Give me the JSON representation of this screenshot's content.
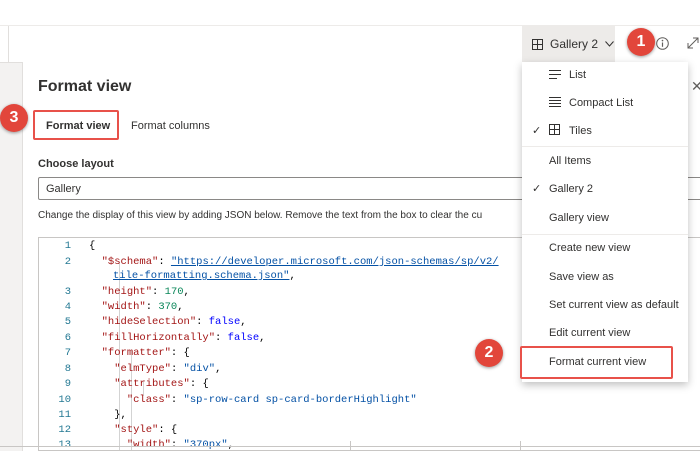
{
  "header": {
    "view_switcher_label": "Gallery 2"
  },
  "panel": {
    "title": "Format view",
    "tabs": [
      {
        "label": "Format view",
        "selected": true
      },
      {
        "label": "Format columns",
        "selected": false
      }
    ],
    "choose_layout_label": "Choose layout",
    "layout_value": "Gallery",
    "help_text": "Change the display of this view by adding JSON below. Remove the text from the box to clear the cu"
  },
  "editor": {
    "line_numbers": [
      "1",
      "2",
      "",
      "3",
      "4",
      "5",
      "6",
      "7",
      "8",
      "9",
      "10",
      "11",
      "12",
      "13"
    ],
    "code": {
      "l1": "{",
      "l2_key": "\"$schema\"",
      "l2_url": "\"https://developer.microsoft.com/json-schemas/sp/v2/",
      "l2b_url": "tile-formatting.schema.json\"",
      "l3_key": "\"height\"",
      "l3_val": "170",
      "l4_key": "\"width\"",
      "l4_val": "370",
      "l5_key": "\"hideSelection\"",
      "l5_val": "false",
      "l6_key": "\"fillHorizontally\"",
      "l6_val": "false",
      "l7_key": "\"formatter\"",
      "l8_key": "\"elmType\"",
      "l8_val": "\"div\"",
      "l9_key": "\"attributes\"",
      "l10_key": "\"class\"",
      "l10_val": "\"sp-row-card sp-card-borderHighlight\"",
      "l11": "},",
      "l12_key": "\"style\"",
      "l13_key": "\"width\"",
      "l13_val": "\"370px\""
    }
  },
  "menu": {
    "items": [
      {
        "label": "List",
        "icon": "list-icon",
        "checked": false
      },
      {
        "label": "Compact List",
        "icon": "compact-list-icon",
        "checked": false
      },
      {
        "label": "Tiles",
        "icon": "tiles-icon",
        "checked": true
      },
      {
        "label": "All Items",
        "checked": false
      },
      {
        "label": "Gallery 2",
        "checked": true
      },
      {
        "label": "Gallery view",
        "checked": false
      },
      {
        "label": "Create new view"
      },
      {
        "label": "Save view as"
      },
      {
        "label": "Set current view as default"
      },
      {
        "label": "Edit current view"
      },
      {
        "label": "Format current view"
      }
    ]
  },
  "callouts": [
    "1",
    "2",
    "3"
  ],
  "colors": {
    "callout_red": "#e2463b",
    "accent": "#0078d4"
  }
}
